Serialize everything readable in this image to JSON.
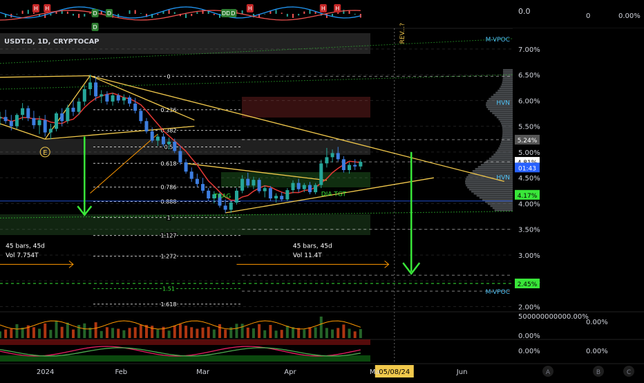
{
  "chart_data": {
    "type": "candlestick",
    "symbol_label": "USDT.D, 1D, CRYPTOCAP",
    "top_panel": {
      "value_label": "0.0",
      "right_values": [
        "0",
        "0.00%"
      ],
      "signal_markers": [
        {
          "label": "H",
          "kind": "sell",
          "date": "2024-01-02"
        },
        {
          "label": "H",
          "kind": "sell",
          "date": "2024-01-06"
        },
        {
          "label": "D",
          "kind": "buy",
          "date": "2024-01-23"
        },
        {
          "label": "D",
          "kind": "buy",
          "date": "2024-01-23"
        },
        {
          "label": "D",
          "kind": "buy",
          "date": "2024-01-28"
        },
        {
          "label": "DD",
          "kind": "buy",
          "date": "2024-03-09"
        },
        {
          "label": "D",
          "kind": "buy",
          "date": "2024-03-12"
        },
        {
          "label": "H",
          "kind": "sell",
          "date": "2024-03-18"
        },
        {
          "label": "H",
          "kind": "sell",
          "date": "2024-04-13"
        },
        {
          "label": "H",
          "kind": "sell",
          "date": "2024-04-18"
        }
      ]
    },
    "y_axis": {
      "ticks": [
        "7.00%",
        "6.50%",
        "6.00%",
        "5.50%",
        "5.00%",
        "4.50%",
        "4.00%",
        "3.50%",
        "3.00%",
        "2.50%",
        "2.00%"
      ],
      "ylim": [
        1.9,
        7.4
      ]
    },
    "x_axis": {
      "ticks": [
        {
          "label": "2024",
          "date": "2024-01-01"
        },
        {
          "label": "Feb",
          "date": "2024-02-01"
        },
        {
          "label": "Mar",
          "date": "2024-03-01"
        },
        {
          "label": "Apr",
          "date": "2024-04-01"
        },
        {
          "label": "Ma",
          "date": "2024-05-01"
        },
        {
          "label": "Jun",
          "date": "2024-06-01"
        }
      ],
      "xlim": [
        "2023-12-20",
        "2024-06-19"
      ]
    },
    "price_labels": [
      {
        "text": "5.24%",
        "value": 5.24,
        "style": "grey"
      },
      {
        "text": "4.81%",
        "value": 4.81,
        "style": "white"
      },
      {
        "text": "01:43",
        "value": 4.7,
        "style": "blue"
      },
      {
        "text": "4.17%",
        "value": 4.17,
        "style": "green"
      },
      {
        "text": "2.45%",
        "value": 2.45,
        "style": "green"
      }
    ],
    "level_labels": [
      {
        "text": "HVN",
        "value": 5.97
      },
      {
        "text": "HVN",
        "value": 4.52
      },
      {
        "text": "M-VPOC",
        "value": 2.3
      },
      {
        "text": "M-VPOC",
        "value": 7.2
      }
    ],
    "fib_levels": [
      {
        "label": "0",
        "value": 6.47
      },
      {
        "label": "0.236",
        "value": 5.82
      },
      {
        "label": "0.382",
        "value": 5.42
      },
      {
        "label": "0.5",
        "value": 5.1
      },
      {
        "label": "0.618",
        "value": 4.78
      },
      {
        "label": "0.786",
        "value": 4.32
      },
      {
        "label": "0.888",
        "value": 4.04
      },
      {
        "label": "1",
        "value": 3.73
      },
      {
        "label": "1.127",
        "value": 3.38
      },
      {
        "label": "1.272",
        "value": 2.98
      },
      {
        "label": "1.51",
        "value": 2.35
      },
      {
        "label": "1.618",
        "value": 2.05
      }
    ],
    "annotations": [
      {
        "text": "E",
        "date": "2024-01-05",
        "value": 5.0
      },
      {
        "text": "TRAG",
        "date": "2024-03-05",
        "value": 4.15
      },
      {
        "text": "DIA TGT",
        "date": "2024-04-12",
        "value": 4.19
      },
      {
        "text": "45 bars, 45d",
        "date": "2023-12-21",
        "value": 3.18
      },
      {
        "text": "Vol 7.754T",
        "date": "2023-12-21",
        "value": 3.0
      },
      {
        "text": "45 bars, 45d",
        "date": "2024-04-01",
        "value": 3.18
      },
      {
        "text": "Vol 11.4T",
        "date": "2024-04-01",
        "value": 3.0
      },
      {
        "text": "REV...?",
        "date": "2024-05-14",
        "value": 7.1
      },
      {
        "text": "05/08/24",
        "date": "2024-05-08",
        "value": null
      }
    ],
    "candles": [
      {
        "date": "2023-12-20",
        "o": 5.65,
        "h": 5.78,
        "l": 5.52,
        "c": 5.68
      },
      {
        "date": "2023-12-22",
        "o": 5.68,
        "h": 5.82,
        "l": 5.55,
        "c": 5.6
      },
      {
        "date": "2023-12-24",
        "o": 5.6,
        "h": 5.72,
        "l": 5.42,
        "c": 5.5
      },
      {
        "date": "2023-12-26",
        "o": 5.5,
        "h": 5.75,
        "l": 5.45,
        "c": 5.72
      },
      {
        "date": "2023-12-28",
        "o": 5.72,
        "h": 5.95,
        "l": 5.62,
        "c": 5.85
      },
      {
        "date": "2023-12-30",
        "o": 5.85,
        "h": 5.9,
        "l": 5.6,
        "c": 5.66
      },
      {
        "date": "2024-01-01",
        "o": 5.66,
        "h": 5.8,
        "l": 5.45,
        "c": 5.52
      },
      {
        "date": "2024-01-03",
        "o": 5.52,
        "h": 5.7,
        "l": 5.35,
        "c": 5.62
      },
      {
        "date": "2024-01-05",
        "o": 5.62,
        "h": 5.72,
        "l": 5.3,
        "c": 5.38
      },
      {
        "date": "2024-01-07",
        "o": 5.38,
        "h": 5.55,
        "l": 5.25,
        "c": 5.45
      },
      {
        "date": "2024-01-09",
        "o": 5.45,
        "h": 5.78,
        "l": 5.4,
        "c": 5.75
      },
      {
        "date": "2024-01-11",
        "o": 5.75,
        "h": 5.85,
        "l": 5.5,
        "c": 5.6
      },
      {
        "date": "2024-01-13",
        "o": 5.6,
        "h": 5.92,
        "l": 5.55,
        "c": 5.86
      },
      {
        "date": "2024-01-15",
        "o": 5.86,
        "h": 6.0,
        "l": 5.7,
        "c": 5.78
      },
      {
        "date": "2024-01-17",
        "o": 5.78,
        "h": 6.05,
        "l": 5.72,
        "c": 5.98
      },
      {
        "date": "2024-01-19",
        "o": 5.98,
        "h": 6.3,
        "l": 5.9,
        "c": 6.22
      },
      {
        "date": "2024-01-21",
        "o": 6.22,
        "h": 6.5,
        "l": 6.1,
        "c": 6.35
      },
      {
        "date": "2024-01-23",
        "o": 6.35,
        "h": 6.46,
        "l": 6.0,
        "c": 6.08
      },
      {
        "date": "2024-01-25",
        "o": 6.08,
        "h": 6.2,
        "l": 5.95,
        "c": 6.12
      },
      {
        "date": "2024-01-27",
        "o": 6.12,
        "h": 6.18,
        "l": 5.92,
        "c": 5.98
      },
      {
        "date": "2024-01-29",
        "o": 5.98,
        "h": 6.15,
        "l": 5.9,
        "c": 6.1
      },
      {
        "date": "2024-01-31",
        "o": 6.1,
        "h": 6.14,
        "l": 5.95,
        "c": 6.0
      },
      {
        "date": "2024-02-02",
        "o": 6.0,
        "h": 6.12,
        "l": 5.92,
        "c": 6.06
      },
      {
        "date": "2024-02-04",
        "o": 6.06,
        "h": 6.1,
        "l": 5.88,
        "c": 5.94
      },
      {
        "date": "2024-02-06",
        "o": 5.94,
        "h": 6.05,
        "l": 5.75,
        "c": 5.8
      },
      {
        "date": "2024-02-08",
        "o": 5.8,
        "h": 5.85,
        "l": 5.55,
        "c": 5.6
      },
      {
        "date": "2024-02-10",
        "o": 5.6,
        "h": 5.66,
        "l": 5.36,
        "c": 5.4
      },
      {
        "date": "2024-02-12",
        "o": 5.4,
        "h": 5.48,
        "l": 5.18,
        "c": 5.22
      },
      {
        "date": "2024-02-14",
        "o": 5.22,
        "h": 5.35,
        "l": 5.12,
        "c": 5.3
      },
      {
        "date": "2024-02-16",
        "o": 5.3,
        "h": 5.36,
        "l": 5.1,
        "c": 5.15
      },
      {
        "date": "2024-02-18",
        "o": 5.15,
        "h": 5.28,
        "l": 5.05,
        "c": 5.2
      },
      {
        "date": "2024-02-20",
        "o": 5.2,
        "h": 5.26,
        "l": 4.98,
        "c": 5.02
      },
      {
        "date": "2024-02-22",
        "o": 5.02,
        "h": 5.12,
        "l": 4.75,
        "c": 4.8
      },
      {
        "date": "2024-02-24",
        "o": 4.8,
        "h": 4.86,
        "l": 4.58,
        "c": 4.62
      },
      {
        "date": "2024-02-26",
        "o": 4.62,
        "h": 4.7,
        "l": 4.42,
        "c": 4.48
      },
      {
        "date": "2024-02-28",
        "o": 4.48,
        "h": 4.58,
        "l": 4.32,
        "c": 4.38
      },
      {
        "date": "2024-03-01",
        "o": 4.38,
        "h": 4.5,
        "l": 4.2,
        "c": 4.25
      },
      {
        "date": "2024-03-03",
        "o": 4.25,
        "h": 4.3,
        "l": 4.05,
        "c": 4.1
      },
      {
        "date": "2024-03-05",
        "o": 4.1,
        "h": 4.24,
        "l": 4.0,
        "c": 4.18
      },
      {
        "date": "2024-03-07",
        "o": 4.18,
        "h": 4.22,
        "l": 3.92,
        "c": 3.96
      },
      {
        "date": "2024-03-09",
        "o": 3.96,
        "h": 4.08,
        "l": 3.82,
        "c": 3.88
      },
      {
        "date": "2024-03-11",
        "o": 3.88,
        "h": 4.05,
        "l": 3.82,
        "c": 4.02
      },
      {
        "date": "2024-03-13",
        "o": 4.02,
        "h": 4.3,
        "l": 3.98,
        "c": 4.25
      },
      {
        "date": "2024-03-15",
        "o": 4.25,
        "h": 4.55,
        "l": 4.2,
        "c": 4.48
      },
      {
        "date": "2024-03-17",
        "o": 4.48,
        "h": 4.6,
        "l": 4.3,
        "c": 4.35
      },
      {
        "date": "2024-03-19",
        "o": 4.35,
        "h": 4.52,
        "l": 4.28,
        "c": 4.46
      },
      {
        "date": "2024-03-21",
        "o": 4.46,
        "h": 4.5,
        "l": 4.2,
        "c": 4.24
      },
      {
        "date": "2024-03-23",
        "o": 4.24,
        "h": 4.35,
        "l": 4.12,
        "c": 4.3
      },
      {
        "date": "2024-03-25",
        "o": 4.3,
        "h": 4.34,
        "l": 4.05,
        "c": 4.1
      },
      {
        "date": "2024-03-27",
        "o": 4.1,
        "h": 4.2,
        "l": 4.02,
        "c": 4.15
      },
      {
        "date": "2024-03-29",
        "o": 4.15,
        "h": 4.22,
        "l": 4.04,
        "c": 4.08
      },
      {
        "date": "2024-03-31",
        "o": 4.08,
        "h": 4.3,
        "l": 4.05,
        "c": 4.26
      },
      {
        "date": "2024-04-02",
        "o": 4.26,
        "h": 4.45,
        "l": 4.2,
        "c": 4.4
      },
      {
        "date": "2024-04-04",
        "o": 4.4,
        "h": 4.48,
        "l": 4.22,
        "c": 4.28
      },
      {
        "date": "2024-04-06",
        "o": 4.28,
        "h": 4.4,
        "l": 4.22,
        "c": 4.36
      },
      {
        "date": "2024-04-08",
        "o": 4.36,
        "h": 4.42,
        "l": 4.18,
        "c": 4.22
      },
      {
        "date": "2024-04-10",
        "o": 4.22,
        "h": 4.4,
        "l": 4.18,
        "c": 4.36
      },
      {
        "date": "2024-04-12",
        "o": 4.36,
        "h": 4.85,
        "l": 4.3,
        "c": 4.78
      },
      {
        "date": "2024-04-14",
        "o": 4.78,
        "h": 5.08,
        "l": 4.7,
        "c": 4.9
      },
      {
        "date": "2024-04-16",
        "o": 4.9,
        "h": 5.05,
        "l": 4.8,
        "c": 4.98
      },
      {
        "date": "2024-04-18",
        "o": 4.98,
        "h": 5.1,
        "l": 4.82,
        "c": 4.86
      },
      {
        "date": "2024-04-20",
        "o": 4.86,
        "h": 4.92,
        "l": 4.6,
        "c": 4.65
      },
      {
        "date": "2024-04-22",
        "o": 4.65,
        "h": 4.8,
        "l": 4.58,
        "c": 4.75
      },
      {
        "date": "2024-04-24",
        "o": 4.75,
        "h": 4.86,
        "l": 4.65,
        "c": 4.72
      },
      {
        "date": "2024-04-26",
        "o": 4.72,
        "h": 4.86,
        "l": 4.66,
        "c": 4.81
      }
    ],
    "sma_color": "#e53935",
    "volume_panel": {
      "value_label": "500000000000.00%",
      "right_values": [
        "0.00%",
        "0.00%"
      ]
    },
    "oscillator_panel": {
      "value_label": "0.00%",
      "right_values": [
        "0.00%"
      ]
    }
  },
  "footer": {
    "buttons": [
      "A",
      "B",
      "C"
    ]
  },
  "colors": {
    "up": "#26a69a",
    "down": "#3d7ee0",
    "fib": "#ffffff",
    "triangle": "#f2c94c",
    "arrow_green": "#39e639",
    "arrow_orange": "#ff9800",
    "accent_blue": "#2962ff"
  }
}
